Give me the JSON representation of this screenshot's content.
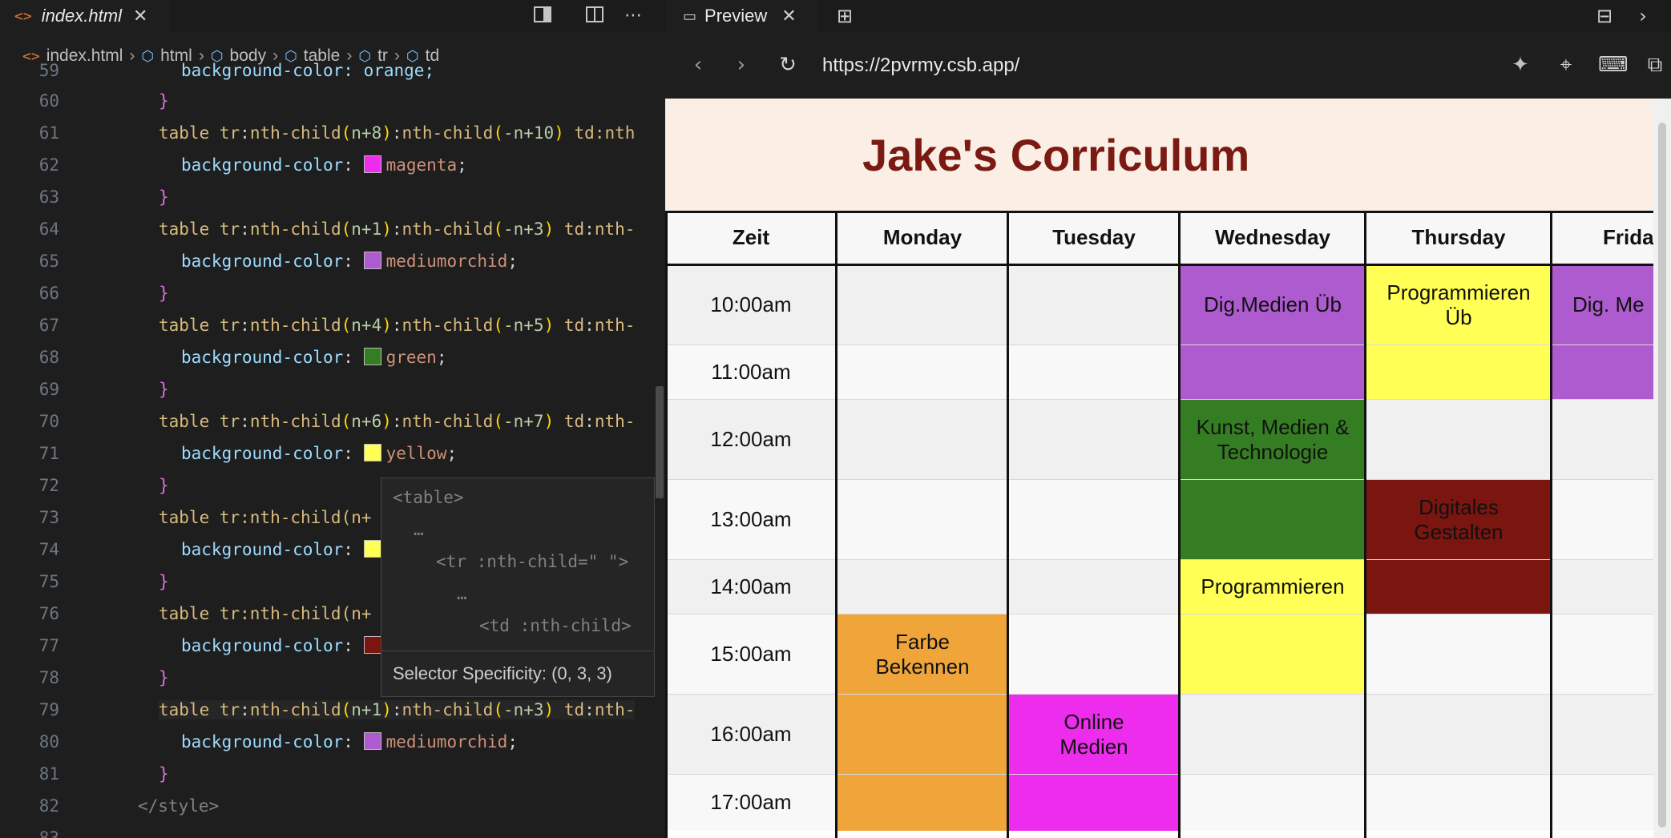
{
  "editor": {
    "tab": {
      "icon": "<>",
      "label": "index.html"
    },
    "breadcrumb": [
      "index.html",
      "html",
      "body",
      "table",
      "tr",
      "td"
    ],
    "lines": [
      {
        "n": "59",
        "t": "background-color: orange;"
      },
      {
        "n": "60"
      },
      {
        "n": "61"
      },
      {
        "n": "62"
      },
      {
        "n": "63"
      },
      {
        "n": "64"
      },
      {
        "n": "65"
      },
      {
        "n": "66"
      },
      {
        "n": "67"
      },
      {
        "n": "68"
      },
      {
        "n": "69"
      },
      {
        "n": "70"
      },
      {
        "n": "71"
      },
      {
        "n": "72"
      },
      {
        "n": "73"
      },
      {
        "n": "74"
      },
      {
        "n": "75"
      },
      {
        "n": "76"
      },
      {
        "n": "77"
      },
      {
        "n": "78"
      },
      {
        "n": "79"
      },
      {
        "n": "80"
      },
      {
        "n": "81"
      },
      {
        "n": "82"
      },
      {
        "n": "83"
      }
    ],
    "code": {
      "l61_a": "table",
      "l61_b": "tr",
      "l61_c": "nth-child",
      "l61_d": "n+8",
      "l61_e": "nth-child",
      "l61_f": "-n+10",
      "l61_g": "td",
      "l61_h": ":nth",
      "l62_prop": "background-color",
      "l62_val": "magenta",
      "l64_d": "n+1",
      "l64_f": "-n+3",
      "l64_h": "nth-",
      "l65_val": "mediumorchid",
      "l67_d": "n+4",
      "l67_f": "-n+5",
      "l68_val": "green",
      "l70_d": "n+6",
      "l70_f": "-n+7",
      "l71_val": "yellow",
      "l73_pre": "table tr:nth-child(n+",
      "l76_pre": "table tr:nth-child(n+",
      "l79_d": "n+1",
      "l79_f": "-n+3",
      "l80_val": "mediumorchid",
      "l82": "</style>"
    },
    "colors": {
      "magenta": "#ee2cee",
      "mediumorchid": "#ad5bcf",
      "green": "#357d22",
      "yellow": "#ffff55",
      "darkred": "#7a1510",
      "orange": "#f0a53b"
    },
    "tooltip": {
      "line1": "<table>",
      "line2": "…",
      "line3": "<tr :nth-child=\" \">",
      "line4": "…",
      "line5": "<td :nth-child>",
      "specificity": "Selector Specificity: (0, 3, 3)"
    }
  },
  "preview": {
    "tab_label": "Preview",
    "url": "https://2pvrmy.csb.app/",
    "page": {
      "title": "Jake's Corriculum",
      "headers": [
        "Zeit",
        "Monday",
        "Tuesday",
        "Wednesday",
        "Thursday",
        "Frida"
      ],
      "times": [
        "10:00am",
        "11:00am",
        "12:00am",
        "13:00am",
        "14:00am",
        "15:00am",
        "16:00am",
        "17:00am"
      ],
      "events": {
        "wed_10": "Dig.Medien Üb",
        "thu_10": "Programmieren Üb",
        "fri_10": "Dig. Me",
        "wed_12": "Kunst, Medien & Technologie",
        "thu_13": "Digitales Gestalten",
        "wed_14": "Programmieren",
        "mon_15": "Farbe Bekennen",
        "tue_16": "Online Medien"
      },
      "colors": {
        "title": "#7a1a12",
        "header_bg": "#faeee5",
        "orchid": "#ad5bcf",
        "yellow": "#ffff55",
        "green": "#357d22",
        "darkred": "#7a1510",
        "orange": "#f0a53b",
        "magenta": "#ee2cee"
      }
    }
  }
}
